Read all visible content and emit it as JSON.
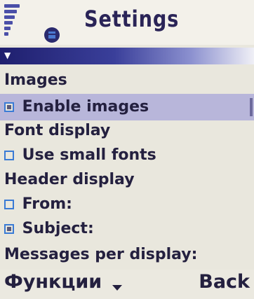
{
  "header": {
    "title": "Settings"
  },
  "icons": {
    "signal": "signal-strength-icon",
    "app": "messaging-app-icon",
    "scroll": "scroll-indicator-icon"
  },
  "colors": {
    "selection": "#b8b6da",
    "accent": "#3a7bd5",
    "title": "#2a2457"
  },
  "list": {
    "images_header": "Images",
    "enable_images": {
      "label": "Enable images",
      "checked": true
    },
    "font_header": "Font display",
    "small_fonts": {
      "label": "Use small fonts",
      "checked": false
    },
    "header_display": "Header display",
    "from": {
      "label": "From:",
      "checked": false
    },
    "subject": {
      "label": "Subject:",
      "checked": true
    },
    "messages_per_display": "Messages per display:"
  },
  "softkeys": {
    "left": "Функции",
    "right": "Back"
  }
}
